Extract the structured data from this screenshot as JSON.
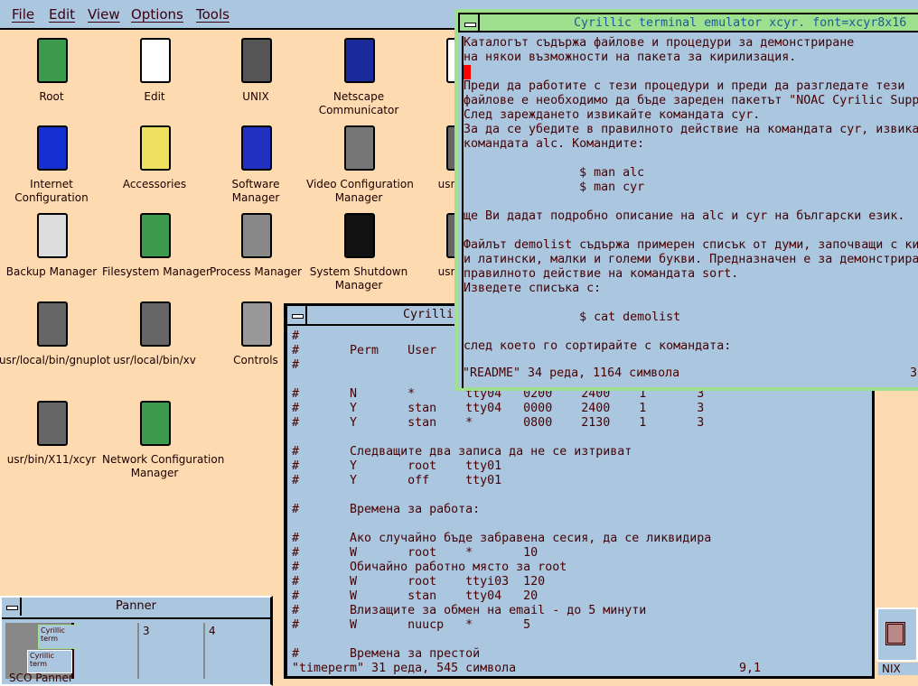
{
  "menubar": {
    "items": [
      "File",
      "Edit",
      "View",
      "Options",
      "Tools"
    ]
  },
  "desktop": {
    "icons": [
      {
        "label": "Root",
        "icon": "file-cabinet-icon"
      },
      {
        "label": "Edit",
        "icon": "notepad-pencil-icon"
      },
      {
        "label": "UNIX",
        "icon": "unix-terminal-icon"
      },
      {
        "label": "Netscape\nCommunicator",
        "icon": "ship-wheel-icon"
      },
      {
        "label": "Internet\nConfiguration",
        "icon": "globe-refresh-icon"
      },
      {
        "label": "Accessories",
        "icon": "toolbox-folder-icon"
      },
      {
        "label": "Software\nManager",
        "icon": "disk-software-icon"
      },
      {
        "label": "Video Configuration\nManager",
        "icon": "monitor-card-icon"
      },
      {
        "label": "usr/local",
        "icon": "computer-icon"
      },
      {
        "label": "Backup Manager",
        "icon": "backup-tape-icon"
      },
      {
        "label": "Filesystem Manager",
        "icon": "filesystem-icon"
      },
      {
        "label": "Process Manager",
        "icon": "process-panel-icon"
      },
      {
        "label": "System Shutdown\nManager",
        "icon": "shutdown-moon-icon"
      },
      {
        "label": "usr/local",
        "icon": "computer-icon"
      },
      {
        "label": "usr/local/bin/gnuplot",
        "icon": "computer-icon"
      },
      {
        "label": "usr/local/bin/xv",
        "icon": "computer-icon"
      },
      {
        "label": "Controls",
        "icon": "folder-gauge-icon"
      },
      {
        "label": "usr/bin/X11/xcyr",
        "icon": "computer-icon"
      },
      {
        "label": "Network Configuration\nManager",
        "icon": "network-card-icon"
      },
      {
        "label": "N",
        "icon": "mail-envelope-icon"
      },
      {
        "label": "NIX",
        "icon": "unix-grid-icon"
      }
    ]
  },
  "terminal1": {
    "title": "Cyrillic terminal emulator xcyr.  font=xcyr8x16",
    "lines": [
      "Каталогът съдържа файлове и процедури за демонстриране",
      "на някои възможности на пакета за кирилизация.",
      "",
      "Преди да работите с тези процедури и преди да разгледате тези",
      "файлове е необходимо да бъде зареден пакетът \"NOAC Cyrilic Supp",
      "След зареждането извикайте командата cyr.",
      "За да се убедите в правилното действие на командата cyr, извика",
      "командата alc. Командите:",
      "",
      "                $ man alc",
      "                $ man cyr",
      "",
      "ще Ви дадат подробно описание на alc и cyr на български език.",
      "",
      "Файлът demolist съдържа примерен списък от думи, започващи с ки",
      "и латински, малки и големи букви. Предназначен е за демонстрира",
      "правилното действие на командата sort.",
      "Изведете списъка с:",
      "",
      "                $ cat demolist",
      "",
      "след което го сортирайте с командата:"
    ],
    "status": "\"README\" 34 реда, 1164 символа",
    "status_right": "3"
  },
  "terminal2": {
    "title": "Cyrillic",
    "lines": [
      "#",
      "#       Perm    User",
      "#",
      "",
      "#       N       *       tty04   0200    2400    1       3",
      "#       Y       stan    tty04   0000    2400    1       3",
      "#       Y       stan    *       0800    2130    1       3",
      "",
      "#       Следващите два записа да не се изтриват",
      "#       Y       root    tty01",
      "#       Y       off     tty01",
      "",
      "#       Времена за работа:",
      "",
      "#       Ако случайно бъде забравена сесия, да се ликвидира",
      "#       W       root    *       10",
      "#       Обичайно работно място за root",
      "#       W       root    ttyi03  120",
      "#       W       stan    tty04   20",
      "#       Влизащите за обмен на email - до 5 минути",
      "#       W       nuucp   *       5",
      "",
      "#       Времена за престой"
    ],
    "status": "\"timeperm\" 31 реда, 545 символа",
    "position": "9,1"
  },
  "panner": {
    "title": "Panner",
    "cells": [
      "",
      "",
      "3",
      "4"
    ],
    "mini_windows": [
      "Cyrillic term",
      "Cyrillic term"
    ],
    "status": "SCO Panner"
  },
  "colors": {
    "desktop": "#fedab0",
    "window": "#abc6df",
    "text": "#4a0000",
    "active_border": "#9fe08f",
    "cursor": "#ff0000"
  }
}
